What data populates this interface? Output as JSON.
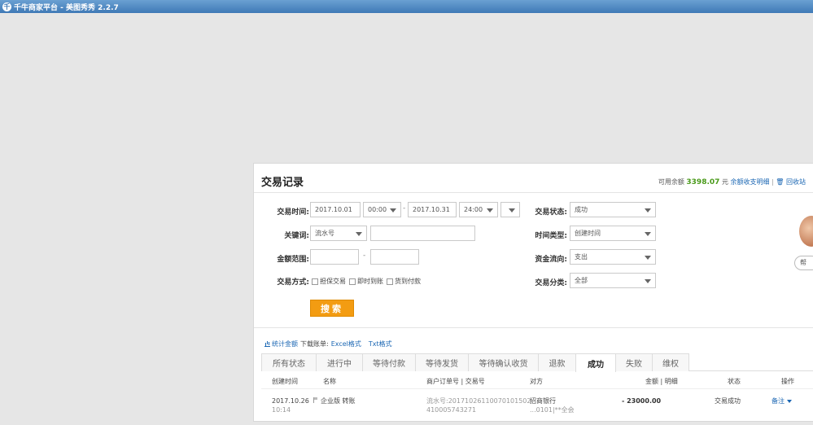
{
  "window": {
    "title": "千牛商家平台 - 美图秀秀 2.2.7",
    "app_icon_glyph": "千"
  },
  "panel": {
    "title": "交易记录",
    "balance": {
      "label": "可用余额",
      "amount": "3398.07",
      "unit": "元",
      "detail_link": "余额收支明细",
      "recycle_link": "回收站"
    }
  },
  "filters": {
    "time": {
      "label": "交易时间:",
      "start_date": "2017.10.01",
      "start_time": "00:00",
      "dash": "-",
      "end_date": "2017.10.31",
      "end_time": "24:00"
    },
    "keyword": {
      "label": "关键词:",
      "type": "流水号",
      "value": ""
    },
    "amount": {
      "label": "金额范围:",
      "min": "",
      "dash": "-",
      "max": ""
    },
    "method": {
      "label": "交易方式:",
      "options": [
        "担保交易",
        "即时到账",
        "货到付款"
      ]
    },
    "status": {
      "label": "交易状态:",
      "value": "成功"
    },
    "time_type": {
      "label": "时间类型:",
      "value": "创建时间"
    },
    "flow": {
      "label": "资金流向:",
      "value": "支出"
    },
    "category": {
      "label": "交易分类:",
      "value": "全部"
    },
    "search_label": "搜索"
  },
  "download": {
    "stats_link": "统计金额",
    "label": "下载账单:",
    "excel_link": "Excel格式",
    "txt_link": "Txt格式"
  },
  "tabs": [
    "所有状态",
    "进行中",
    "等待付款",
    "等待发货",
    "等待确认收货",
    "退款",
    "成功",
    "失败",
    "维权"
  ],
  "active_tab": "成功",
  "columns": {
    "created": "创建时间",
    "name": "名称",
    "order": "商户订单号 | 交易号",
    "party": "对方",
    "amount": "金额 | 明细",
    "status": "状态",
    "action": "操作"
  },
  "rows": [
    {
      "date": "2017.10.26",
      "time": "10:14",
      "name": "企业版 转账",
      "serial": "流水号:20171026110070101502",
      "serial_2": "410005743271",
      "party": "招商银行",
      "party_sub": "...0101|**全会",
      "amount": "- 23000.00",
      "status": "交易成功",
      "action": "备注"
    }
  ],
  "side_widget": {
    "pill_text": "帮"
  },
  "colors": {
    "titlebar": "#3f79b6",
    "search_button": "#f39c12",
    "link": "#1a66b3",
    "balance_amount": "#4a9a1a"
  }
}
